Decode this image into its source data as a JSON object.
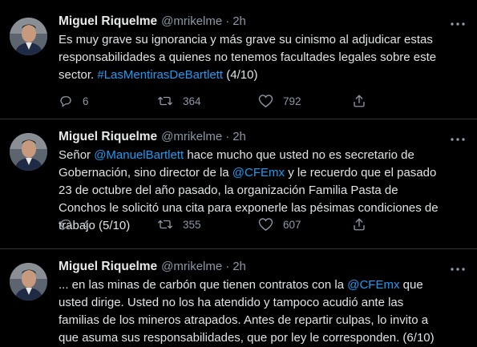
{
  "tweets": [
    {
      "author": "Miguel Riquelme",
      "handle": "@mrikelme",
      "separator": "·",
      "time": "2h",
      "text": [
        {
          "t": "Es muy grave su ignorancia y más grave su cinismo al adjudicar estas responsabilidades a quienes no tenemos facultades legales sobre este sector. "
        },
        {
          "t": "#LasMentirasDeBartlett",
          "link": true
        },
        {
          "t": " (4/10)"
        }
      ],
      "replies": "6",
      "retweets": "364",
      "likes": "792"
    },
    {
      "author": "Miguel Riquelme",
      "handle": "@mrikelme",
      "separator": "·",
      "time": "2h",
      "text": [
        {
          "t": "Señor "
        },
        {
          "t": "@ManuelBartlett",
          "link": true
        },
        {
          "t": " hace mucho que usted no es secretario de Gobernación, sino director de la "
        },
        {
          "t": "@CFEmx",
          "link": true
        },
        {
          "t": " y le recuerdo que el pasado 23 de octubre del año pasado, la organización Familia Pasta de Conchos le solicitó una cita para exponerle las pésimas condiciones de trabajo (5/10)"
        }
      ],
      "replies": "4",
      "retweets": "355",
      "likes": "607"
    },
    {
      "author": "Miguel Riquelme",
      "handle": "@mrikelme",
      "separator": "·",
      "time": "2h",
      "text": [
        {
          "t": "... en las minas de carbón que tienen contratos con la "
        },
        {
          "t": "@CFEmx",
          "link": true
        },
        {
          "t": " que usted dirige. Usted no los ha atendido y tampoco acudió ante las familias de los mineros atrapados. Antes de repartir culpas, lo invito a que asuma sus responsabilidades, que por ley le corresponden. (6/10)"
        }
      ]
    }
  ],
  "icons": {
    "avatar": "profile-photo",
    "more": "more-horizontal-icon",
    "reply": "reply-bubble-icon",
    "retweet": "retweet-arrows-icon",
    "like": "heart-icon",
    "share": "share-upload-icon"
  },
  "colors": {
    "background": "#000000",
    "text": "#d9d9d9",
    "muted": "#8b98a5",
    "link": "#1d9bf0",
    "divider": "#2f3336"
  }
}
